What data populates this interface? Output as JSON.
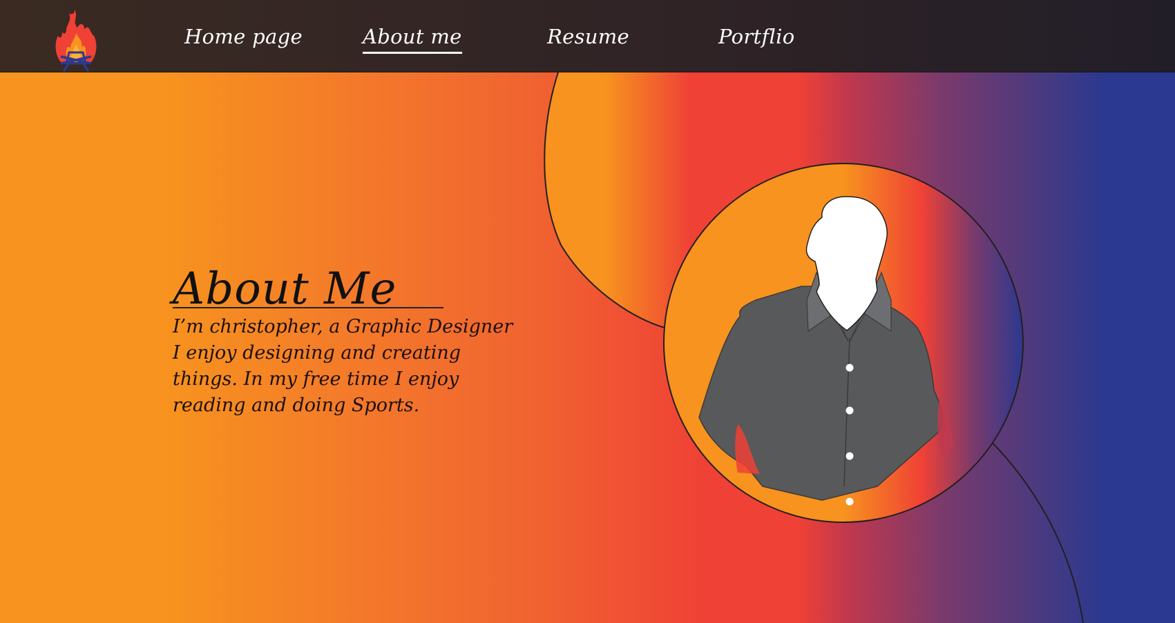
{
  "nav": {
    "logo": "flame-logo",
    "links": [
      {
        "label": "Home page",
        "active": false
      },
      {
        "label": "About me",
        "active": true
      },
      {
        "label": "Resume",
        "active": false
      },
      {
        "label": "Portflio",
        "active": false
      }
    ]
  },
  "about": {
    "heading": "About Me",
    "bio_lines": [
      "I’m christopher, a Graphic Designer",
      "I enjoy designing and creating",
      "things. In my free time I enjoy",
      "reading and doing Sports."
    ]
  },
  "profile": {
    "image": "person-silhouette-icon"
  },
  "colors": {
    "orange": "#f7931e",
    "red": "#ef4136",
    "blue": "#2b3990",
    "nav_dark": "#2f2326",
    "shirt": "#58595b"
  }
}
